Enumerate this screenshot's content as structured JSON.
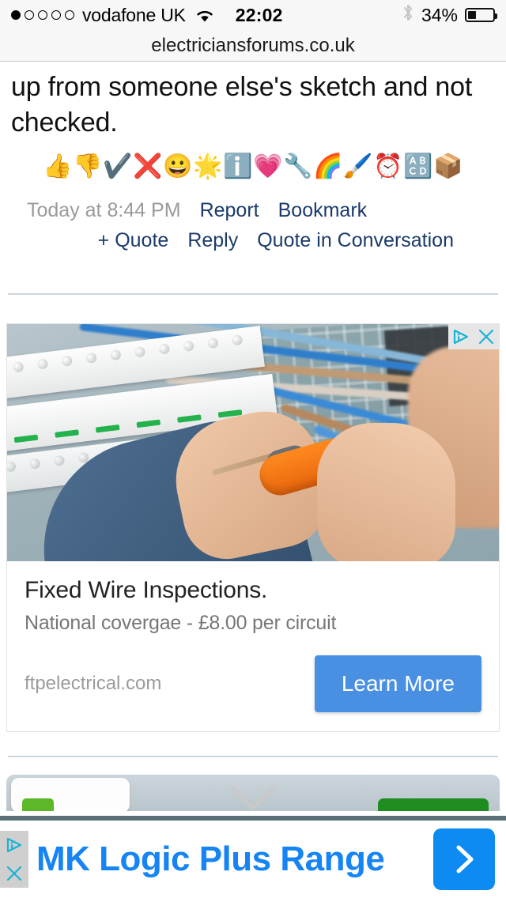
{
  "status_bar": {
    "signal_dots_total": 5,
    "signal_dots_filled": 1,
    "carrier": "vodafone UK",
    "wifi_icon": "wifi-icon",
    "time": "22:02",
    "bluetooth_icon": "bluetooth-icon",
    "battery_percent": "34%",
    "battery_level": 34
  },
  "browser": {
    "url": "electriciansforums.co.uk"
  },
  "post": {
    "body_text": "up from someone else's sketch and not checked.",
    "reactions": [
      {
        "name": "thumbs-up-icon",
        "glyph": "👍"
      },
      {
        "name": "thumbs-down-icon",
        "glyph": "👎"
      },
      {
        "name": "check-mark-icon",
        "glyph": "✔️"
      },
      {
        "name": "cross-mark-icon",
        "glyph": "❌"
      },
      {
        "name": "grinning-face-icon",
        "glyph": "😀"
      },
      {
        "name": "star-medal-icon",
        "glyph": "🌟"
      },
      {
        "name": "information-icon",
        "glyph": "ℹ️"
      },
      {
        "name": "heart-icon",
        "glyph": "💗"
      },
      {
        "name": "wrench-icon",
        "glyph": "🔧"
      },
      {
        "name": "rainbow-icon",
        "glyph": "🌈"
      },
      {
        "name": "paintbrush-icon",
        "glyph": "🖌️"
      },
      {
        "name": "alarm-clock-icon",
        "glyph": "⏰"
      },
      {
        "name": "abc-check-icon",
        "glyph": "🔠"
      },
      {
        "name": "package-box-icon",
        "glyph": "📦"
      }
    ],
    "timestamp": "Today at 8:44 PM",
    "actions_row1": [
      "Report",
      "Bookmark"
    ],
    "actions_row2": [
      "+ Quote",
      "Reply",
      "Quote in Conversation"
    ]
  },
  "ad_card": {
    "adchoices_icon": "adchoices-icon",
    "close_icon": "close-icon",
    "image_alt": "electrician-working-on-consumer-unit",
    "title": "Fixed Wire Inspections.",
    "description": "National covergae - £8.00 per circuit",
    "display_url": "ftpelectrical.com",
    "cta_label": "Learn More",
    "cta_color": "#4a90e2"
  },
  "bottom_banner": {
    "adchoices_icon": "adchoices-icon",
    "close_icon": "close-icon",
    "text": "MK Logic Plus Range",
    "text_color": "#1684f2",
    "cta_icon": "chevron-right-icon",
    "cta_color": "#0d8bf2"
  }
}
